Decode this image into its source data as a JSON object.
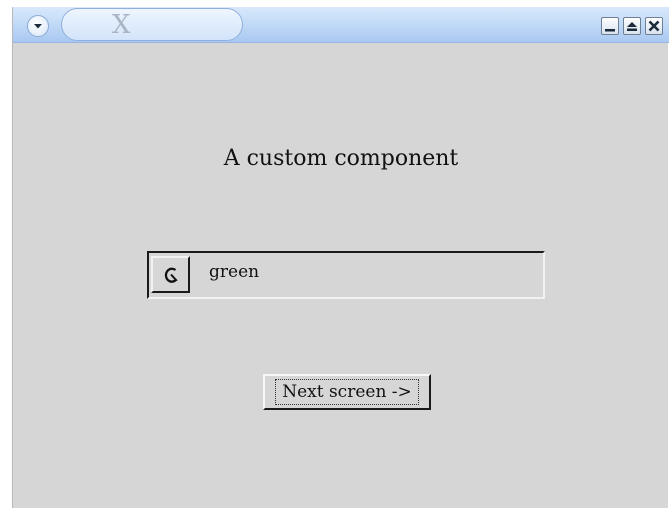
{
  "window": {
    "title": "X",
    "buttons": {
      "menu_icon": "chevron-down-icon",
      "minimize_icon": "minimize-icon",
      "maximize_icon": "maximize-icon",
      "close_icon": "close-icon"
    }
  },
  "main": {
    "heading": "A custom component",
    "combo": {
      "icon": "refresh-icon",
      "value": "green"
    },
    "next_button_label": "Next screen ->"
  }
}
